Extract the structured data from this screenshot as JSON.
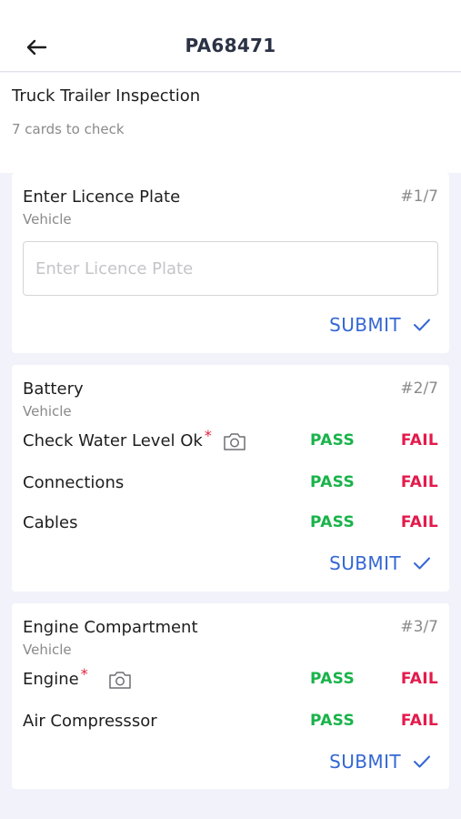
{
  "header": {
    "title": "PA68471",
    "back_icon": "arrow-left-icon"
  },
  "inspection": {
    "name": "Truck Trailer Inspection",
    "subtitle": "7 cards to check"
  },
  "cards": [
    {
      "title": "Enter Licence Plate",
      "category": "Vehicle",
      "number": "#1/7",
      "input": {
        "placeholder": "Enter Licence Plate",
        "value": ""
      },
      "submit_label": "SUBMIT"
    },
    {
      "title": "Battery",
      "category": "Vehicle",
      "number": "#2/7",
      "items": [
        {
          "label": "Check Water Level Ok",
          "required": "*",
          "camera": true,
          "pass": "PASS",
          "fail": "FAIL"
        },
        {
          "label": "Connections",
          "required": "",
          "camera": false,
          "pass": "PASS",
          "fail": "FAIL"
        },
        {
          "label": "Cables",
          "required": "",
          "camera": false,
          "pass": "PASS",
          "fail": "FAIL"
        }
      ],
      "submit_label": "SUBMIT"
    },
    {
      "title": "Engine Compartment",
      "category": "Vehicle",
      "number": "#3/7",
      "items": [
        {
          "label": "Engine",
          "required": "*",
          "camera": true,
          "pass": "PASS",
          "fail": "FAIL"
        },
        {
          "label": "Air Compresssor",
          "required": "",
          "camera": false,
          "pass": "PASS",
          "fail": "FAIL"
        }
      ],
      "submit_label": "SUBMIT"
    }
  ],
  "colors": {
    "pass": "#19b34a",
    "fail": "#e41a4b",
    "submit": "#3467d4",
    "required": "#e0213c",
    "background": "#f2f2fa"
  }
}
